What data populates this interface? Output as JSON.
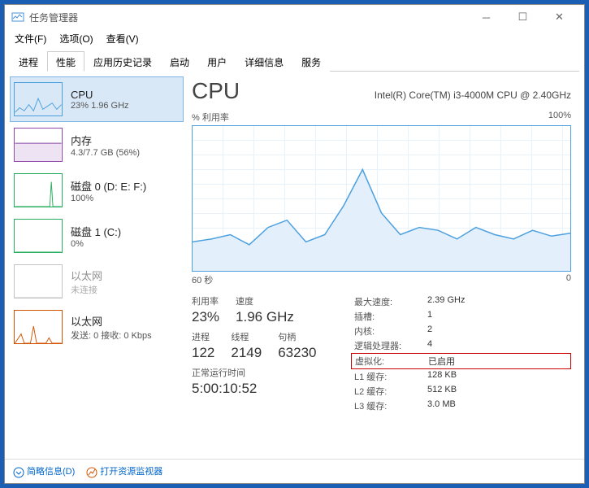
{
  "window": {
    "title": "任务管理器"
  },
  "menu": {
    "file": "文件(F)",
    "options": "选项(O)",
    "view": "查看(V)"
  },
  "tabs": [
    "进程",
    "性能",
    "应用历史记录",
    "启动",
    "用户",
    "详细信息",
    "服务"
  ],
  "activeTab": 1,
  "sidebar": [
    {
      "name": "CPU",
      "sub": "23% 1.96 GHz",
      "color": "#4da0df",
      "selected": true,
      "spark": "0,38 6,32 12,36 18,28 24,36 30,20 36,34 42,30 48,26 54,34 60,28"
    },
    {
      "name": "内存",
      "sub": "4.3/7.7 GB (56%)",
      "color": "#8e44ad",
      "spark": "0,19 60,19",
      "fill": true
    },
    {
      "name": "磁盘 0 (D: E: F:)",
      "sub": "100%",
      "color": "#27ae60",
      "spark": "0,42 45,42 47,10 49,42 60,42"
    },
    {
      "name": "磁盘 1 (C:)",
      "sub": "0%",
      "color": "#27ae60",
      "spark": "0,42 60,42"
    },
    {
      "name": "以太网",
      "sub": "未连接",
      "color": "#888",
      "dim": true,
      "spark": "0,42 60,42"
    },
    {
      "name": "以太网",
      "sub": "发送: 0 接收: 0 Kbps",
      "color": "#d35400",
      "spark": "0,42 8,30 12,42 20,42 24,20 28,42 40,42 44,35 48,42 60,42"
    }
  ],
  "cpu": {
    "title": "CPU",
    "model": "Intel(R) Core(TM) i3-4000M CPU @ 2.40GHz",
    "chartLabel": "% 利用率",
    "chartMax": "100%",
    "chartXLeft": "60 秒",
    "chartXRight": "0",
    "stats": {
      "util_lbl": "利用率",
      "util": "23%",
      "speed_lbl": "速度",
      "speed": "1.96 GHz",
      "proc_lbl": "进程",
      "proc": "122",
      "threads_lbl": "线程",
      "threads": "2149",
      "handles_lbl": "句柄",
      "handles": "63230",
      "uptime_lbl": "正常运行时间",
      "uptime": "5:00:10:52"
    },
    "details": [
      {
        "k": "最大速度:",
        "v": "2.39 GHz"
      },
      {
        "k": "插槽:",
        "v": "1"
      },
      {
        "k": "内核:",
        "v": "2"
      },
      {
        "k": "逻辑处理器:",
        "v": "4"
      },
      {
        "k": "虚拟化:",
        "v": "已启用",
        "hl": true
      },
      {
        "k": "L1 缓存:",
        "v": "128 KB"
      },
      {
        "k": "L2 缓存:",
        "v": "512 KB"
      },
      {
        "k": "L3 缓存:",
        "v": "3.0 MB"
      }
    ]
  },
  "footer": {
    "summary": "简略信息(D)",
    "resmon": "打开资源监视器"
  },
  "chart_data": {
    "type": "line",
    "title": "% 利用率",
    "xlabel": "秒",
    "ylabel": "%",
    "xlim": [
      60,
      0
    ],
    "ylim": [
      0,
      100
    ],
    "x": [
      60,
      57,
      54,
      51,
      48,
      45,
      42,
      39,
      36,
      33,
      30,
      27,
      24,
      21,
      18,
      15,
      12,
      9,
      6,
      3,
      0
    ],
    "values": [
      20,
      22,
      25,
      18,
      30,
      35,
      20,
      25,
      45,
      70,
      40,
      25,
      30,
      28,
      22,
      30,
      25,
      22,
      28,
      24,
      26
    ]
  }
}
